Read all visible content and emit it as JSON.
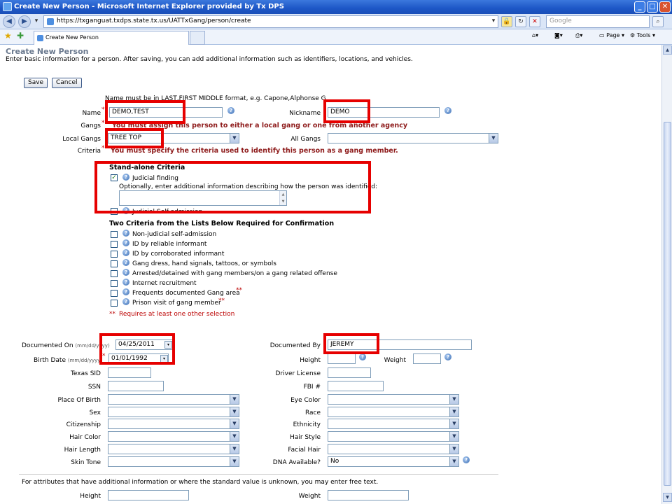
{
  "browser": {
    "window_title": "Create New Person - Microsoft Internet Explorer provided by Tx DPS",
    "url": "https://txganguat.txdps.state.tx.us/UATTxGang/person/create",
    "search_placeholder": "Google",
    "tab_label": "Create New Person",
    "page_menu": "Page",
    "tools_menu": "Tools"
  },
  "page": {
    "title": "Create New Person",
    "subtitle": "Enter basic information for a person. After saving, you can add additional information such as identifiers, locations, and vehicles."
  },
  "buttons": {
    "save": "Save",
    "cancel": "Cancel"
  },
  "form": {
    "name_hint": "Name must be in LAST,FIRST MIDDLE format, e.g. Capone,Alphonse G",
    "name_label": "Name",
    "name_value": "DEMO,TEST",
    "nickname_label": "Nickname",
    "nickname_value": "DEMO",
    "gangs_label": "Gangs",
    "gangs_error": "You must assign this person to either a local gang or one from another agency",
    "local_gangs_label": "Local Gangs",
    "local_gangs_value": "TREE TOP",
    "all_gangs_label": "All Gangs",
    "all_gangs_value": "",
    "criteria_label": "Criteria",
    "criteria_error": "You must specify the criteria used to identify this person as a gang member.",
    "required_marker": "*",
    "double_marker": "**"
  },
  "criteria": {
    "standalone_title": "Stand-alone Criteria",
    "judicial_finding": "Judicial finding",
    "judicial_finding_checked": true,
    "optional_note": "Optionally, enter additional information describing how the person was identified:",
    "judicial_self_admission": "Judicial Self-admission",
    "two_criteria_title": "Two Criteria from the Lists Below Required for Confirmation",
    "items": [
      "Non-judicial self-admission",
      "ID by reliable informant",
      "ID by corroborated informant",
      "Gang dress, hand signals, tattoos, or symbols",
      "Arrested/detained with gang members/on a gang related offense",
      "Internet recruitment",
      "Frequents documented Gang area",
      "Prison visit of gang member"
    ],
    "requires_note": "Requires at least one other selection"
  },
  "details": {
    "documented_on_label": "Documented On",
    "date_format": "(mm/dd/yyyy)",
    "documented_on_value": "04/25/2011",
    "documented_by_label": "Documented By",
    "documented_by_value": "JEREMY",
    "birth_date_label": "Birth Date",
    "birth_date_value": "01/01/1992",
    "height_label": "Height",
    "weight_label": "Weight",
    "texas_sid_label": "Texas SID",
    "driver_license_label": "Driver License",
    "ssn_label": "SSN",
    "fbi_label": "FBI #",
    "place_of_birth_label": "Place Of Birth",
    "eye_color_label": "Eye Color",
    "sex_label": "Sex",
    "race_label": "Race",
    "citizenship_label": "Citizenship",
    "ethnicity_label": "Ethnicity",
    "hair_color_label": "Hair Color",
    "hair_style_label": "Hair Style",
    "hair_length_label": "Hair Length",
    "facial_hair_label": "Facial Hair",
    "skin_tone_label": "Skin Tone",
    "dna_label": "DNA Available?",
    "dna_value": "No",
    "free_text_note": "For attributes that have additional information or where the standard value is unknown, you may enter free text.",
    "height2_label": "Height",
    "weight2_label": "Weight"
  },
  "colors": {
    "highlight": "#e60000",
    "error_text": "#8e1b1b",
    "title_text": "#6b7a8f"
  }
}
